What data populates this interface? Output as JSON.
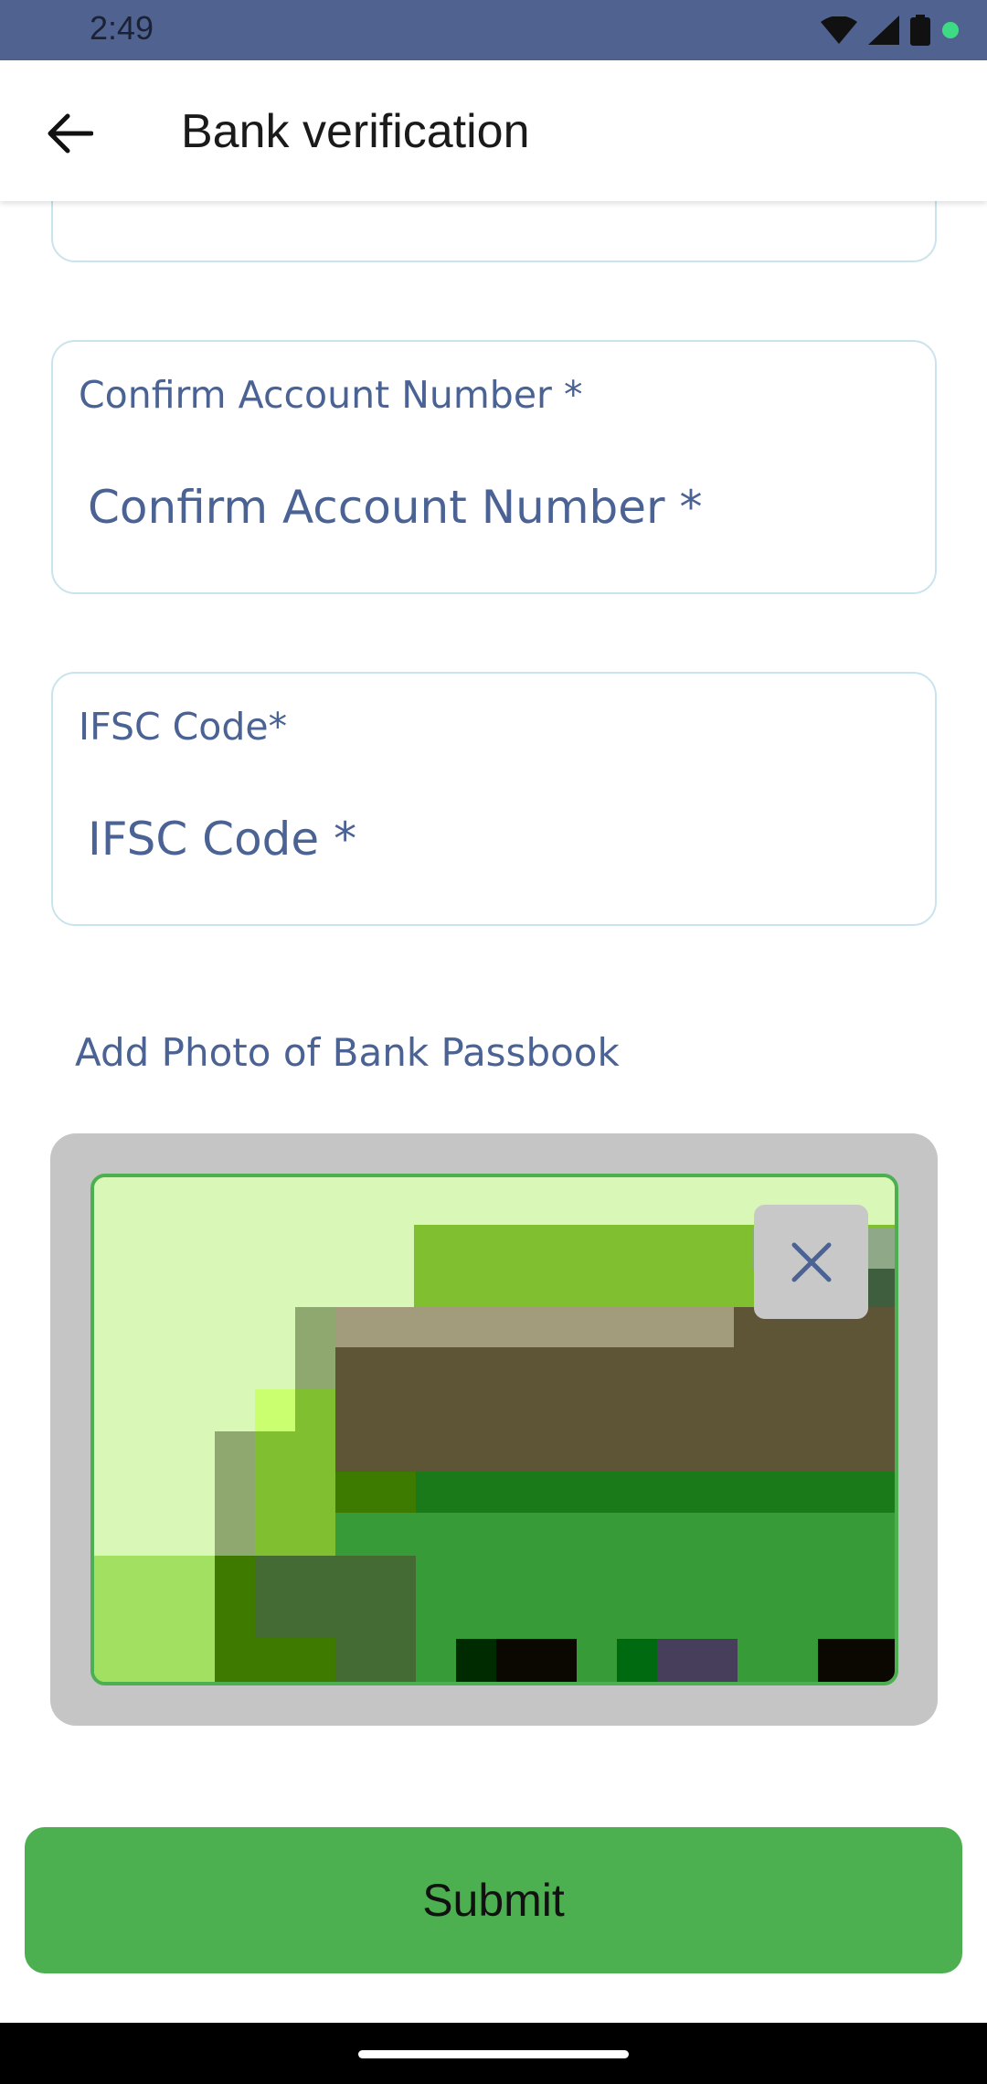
{
  "status_bar": {
    "time": "2:49",
    "icons": [
      "wifi-icon",
      "signal-icon",
      "battery-icon",
      "notification-dot-icon"
    ],
    "color": "#50628f"
  },
  "app_bar": {
    "title": "Bank verification",
    "back_icon": "arrow-left-icon"
  },
  "form": {
    "confirm_account": {
      "label": "Confirm Account Number *",
      "placeholder": "Confirm Account Number *",
      "value": ""
    },
    "ifsc": {
      "label": "IFSC Code*",
      "placeholder": "IFSC Code *",
      "value": ""
    },
    "photo": {
      "label": "Add Photo of Bank Passbook",
      "remove_icon": "close-icon"
    },
    "submit_label": "Submit"
  },
  "colors": {
    "accent": "#4caf50",
    "label_text": "#4a6394",
    "field_border": "#c9e4ec"
  }
}
